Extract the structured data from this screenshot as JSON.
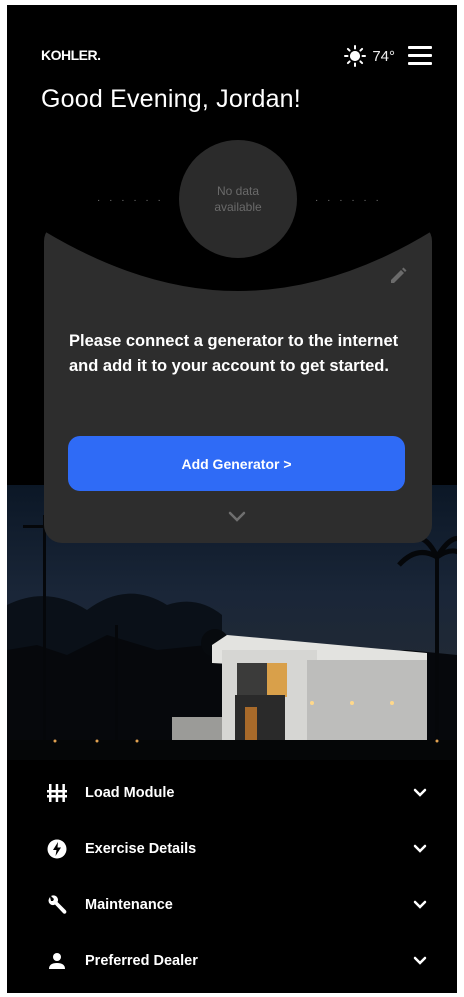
{
  "header": {
    "brand": "KOHLER.",
    "temperature": "74°",
    "greeting": "Good Evening, Jordan!"
  },
  "status_dial": {
    "text": "No data available"
  },
  "card": {
    "message": "Please connect a generator to the internet and add it to your account to get started.",
    "button_label": "Add Generator >"
  },
  "sections": [
    {
      "label": "Load Module",
      "icon": "load-module-icon"
    },
    {
      "label": "Exercise Details",
      "icon": "bolt-icon"
    },
    {
      "label": "Maintenance",
      "icon": "wrench-icon"
    },
    {
      "label": "Preferred Dealer",
      "icon": "person-icon"
    }
  ],
  "colors": {
    "background": "#000000",
    "card": "#2d2d2d",
    "accent": "#2f6bf6"
  }
}
